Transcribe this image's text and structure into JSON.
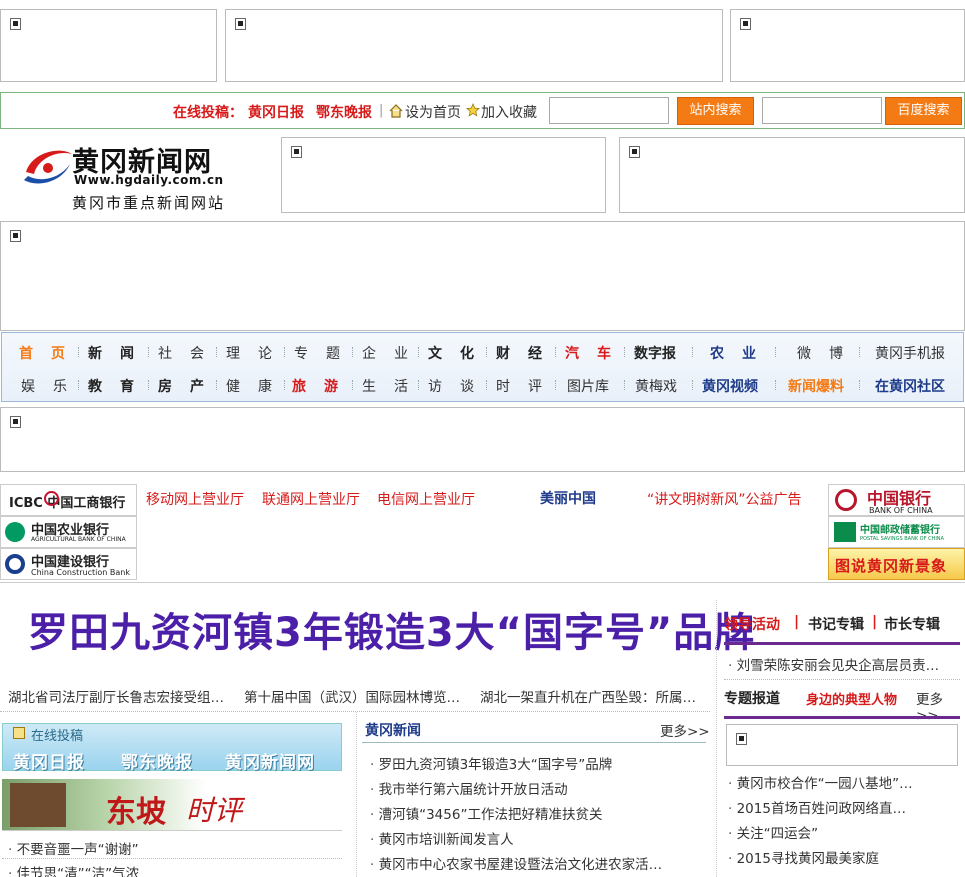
{
  "toolbar": {
    "submit_label": "在线投稿：",
    "papers": [
      "黄冈日报",
      "鄂东晚报"
    ],
    "set_home": "设为首页",
    "add_fav": "加入收藏",
    "site_search_btn": "站内搜索",
    "baidu_search_btn": "百度搜索",
    "site_search_value": "",
    "baidu_search_value": ""
  },
  "logo": {
    "title": "黄冈新闻网",
    "url": "Www.hgdaily.com.cn",
    "slogan": "黄冈市重点新闻网站"
  },
  "nav": {
    "row1": [
      "首　页",
      "新　闻",
      "社　会",
      "理　论",
      "专　题",
      "企　业",
      "文　化",
      "财　经",
      "汽　车",
      "数字报",
      "农　业",
      "微　博",
      "黄冈手机报"
    ],
    "row2": [
      "娱　乐",
      "教　育",
      "房　产",
      "健　康",
      "旅　游",
      "生　活",
      "访　谈",
      "时　评",
      "图片库",
      "黄梅戏",
      "黄冈视频",
      "新闻爆料",
      "在黄冈社区"
    ]
  },
  "banks": {
    "icbc": "ICBC 中国工商银行",
    "abc_cn": "中国农业银行",
    "abc_en": "AGRICULTURAL BANK OF CHINA",
    "ccb_cn": "中国建设银行",
    "ccb_en": "China Construction Bank",
    "boc_cn": "中国银行",
    "boc_en": "BANK OF CHINA",
    "psbc_cn": "中国邮政储蓄银行",
    "psbc_en": "POSTAL SAVINGS BANK OF CHINA",
    "tushuo": "图说黄冈新景象"
  },
  "promo_links": [
    "移动网上营业厅",
    "联通网上营业厅",
    "电信网上营业厅",
    "美丽中国",
    "“讲文明树新风”公益广告"
  ],
  "headline": "罗田九资河镇3年锻造3大“国字号”品牌",
  "subnews": [
    "湖北省司法厅副厅长鲁志宏接受组…",
    "第十届中国（武汉）国际园林博览…",
    "湖北一架直升机在广西坠毁：所属…"
  ],
  "right": {
    "tabs": [
      "领导活动",
      "书记专辑",
      "市长专辑"
    ],
    "leader_news": "刘雪荣陈安丽会见央企高层员责…",
    "special_tabs": [
      "专题报道",
      "身边的典型人物",
      "更多>>"
    ],
    "news": [
      "黄冈市校合作“一园八基地”…",
      "2015首场百姓问政网络直…",
      "关注“四运会”",
      "2015寻找黄冈最美家庭"
    ]
  },
  "left": {
    "tougao_label": "在线投稿",
    "tougao_papers": [
      "黄冈日报",
      "鄂东晚报",
      "黄冈新闻网"
    ],
    "dongpo_a": "东坡",
    "dongpo_b": "时评",
    "items": [
      "不要音噩一声“谢谢”",
      "佳节思“清”“洁”气浓"
    ]
  },
  "middle": {
    "title": "黄冈新闻",
    "more": "更多>>",
    "items": [
      "罗田九资河镇3年锻造3大“国字号”品牌",
      "我市举行第六届统计开放日活动",
      "漕河镇“3456”工作法把好精准扶贫关",
      "黄冈市培训新闻发言人",
      "黄冈市中心农家书屋建设暨法治文化进农家活…"
    ]
  },
  "colors": {
    "accent_red": "#d71a1a",
    "orange_button": "#f47b14",
    "headline_purple": "#4b1fa8",
    "nav_blue": "#1e3b8a"
  }
}
